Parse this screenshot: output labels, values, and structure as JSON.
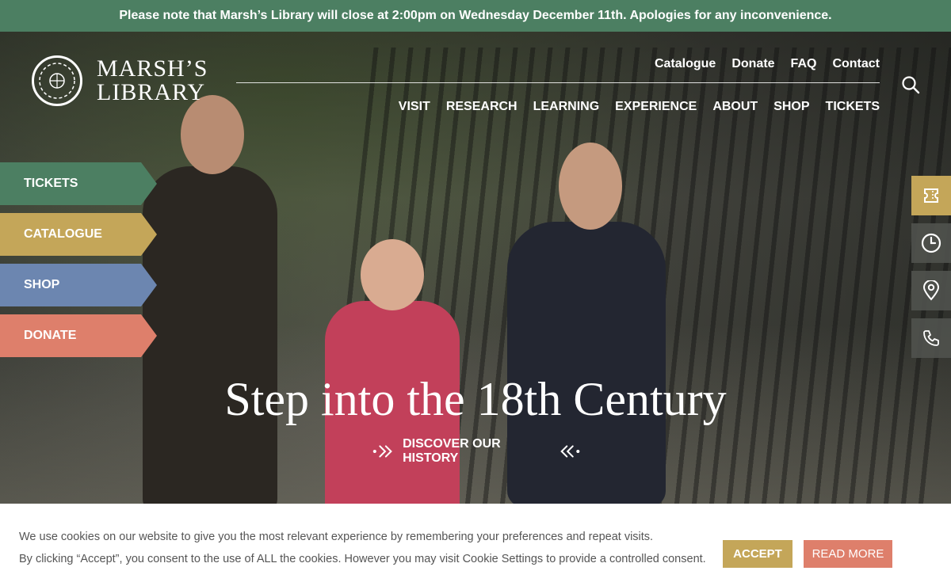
{
  "notice": "Please note that Marsh’s Library will close at 2:00pm on Wednesday December 11th. Apologies for any inconvenience.",
  "logo": {
    "line1": "MARSH’S",
    "line2": "LIBRARY",
    "seal_icon": "marshs-library-seal"
  },
  "utility_nav": [
    "Catalogue",
    "Donate",
    "FAQ",
    "Contact"
  ],
  "main_nav": [
    "VISIT",
    "RESEARCH",
    "LEARNING",
    "EXPERIENCE",
    "ABOUT",
    "SHOP",
    "TICKETS"
  ],
  "search_icon": "search-icon",
  "side_tabs": [
    {
      "label": "TICKETS",
      "color": "#4c7f62"
    },
    {
      "label": "CATALOGUE",
      "color": "#c4a659"
    },
    {
      "label": "SHOP",
      "color": "#6c86b0"
    },
    {
      "label": "DONATE",
      "color": "#de7f6b"
    }
  ],
  "quick_tabs": [
    {
      "icon": "ticket-icon",
      "color": "#c4a659"
    },
    {
      "icon": "clock-icon",
      "color": "#50524e"
    },
    {
      "icon": "location-pin-icon",
      "color": "#50524e"
    },
    {
      "icon": "phone-icon",
      "color": "#50524e"
    }
  ],
  "hero": {
    "title": "Step into the 18th Century",
    "cta": "DISCOVER OUR HISTORY"
  },
  "cookie": {
    "line1": "We use cookies on our website to give you the most relevant experience by remembering your preferences and repeat visits.",
    "line2": "By clicking “Accept”, you consent to the use of ALL the cookies. However you may visit Cookie Settings to provide a controlled consent.",
    "accept": "ACCEPT",
    "read_more": "READ MORE"
  }
}
